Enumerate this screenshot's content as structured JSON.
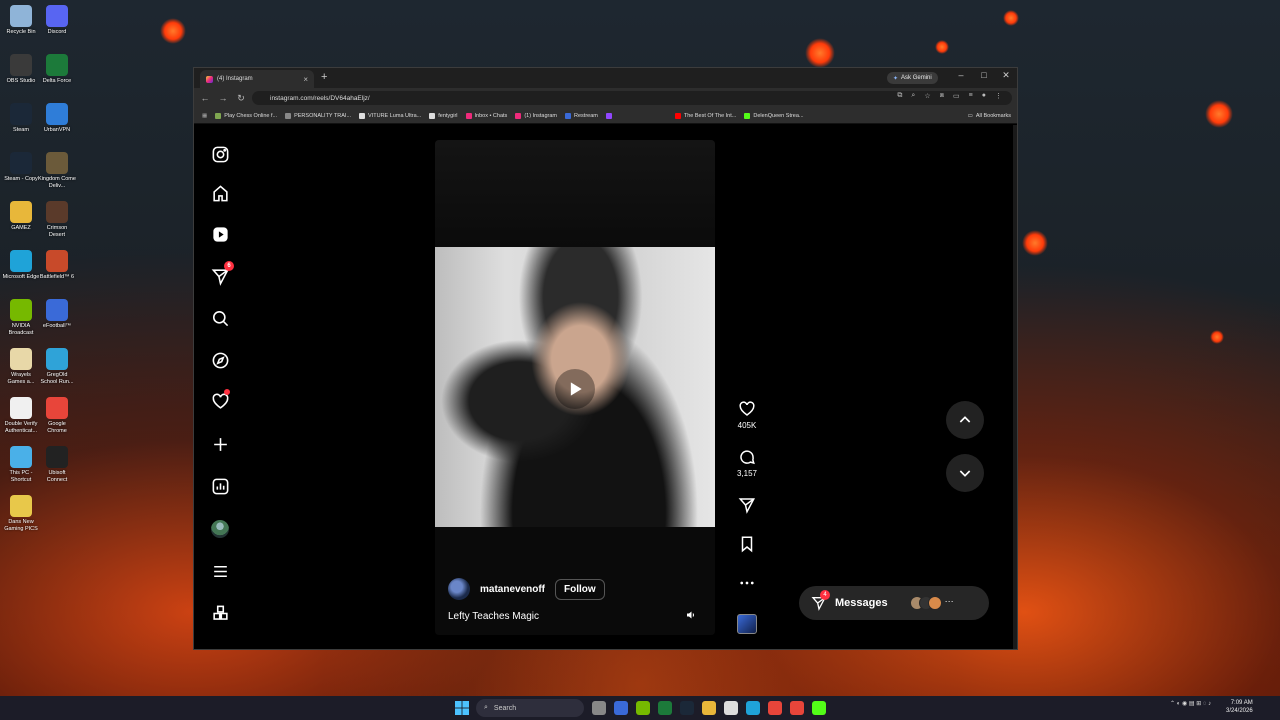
{
  "desktop": {
    "icons": [
      {
        "label": "Recycle Bin",
        "color": "#8fb4d8"
      },
      {
        "label": "Discord",
        "color": "#5865f2"
      },
      {
        "label": "OBS Studio",
        "color": "#3a3a3a"
      },
      {
        "label": "Delta Force",
        "color": "#1c7a3a"
      },
      {
        "label": "Steam",
        "color": "#1b2838"
      },
      {
        "label": "UrbanVPN",
        "color": "#2f7dd8"
      },
      {
        "label": "Steam - Copy",
        "color": "#1b2838"
      },
      {
        "label": "Kingdom Come Deliv...",
        "color": "#6b5a3a"
      },
      {
        "label": "GAMEZ",
        "color": "#e8b73a"
      },
      {
        "label": "Crimson Desert",
        "color": "#5a3a2a"
      },
      {
        "label": "Microsoft Edge",
        "color": "#1fa3d8"
      },
      {
        "label": "Battlefield™ 6",
        "color": "#c84a2a"
      },
      {
        "label": "NVIDIA Broadcast",
        "color": "#76b900"
      },
      {
        "label": "eFootball™",
        "color": "#3a6ad8"
      },
      {
        "label": "Wrayels Games a...",
        "color": "#e8d8a8"
      },
      {
        "label": "GregOld School Run...",
        "color": "#2fa3d8"
      },
      {
        "label": "Double Verify Authenticat...",
        "color": "#f0f0f0"
      },
      {
        "label": "Google Chrome",
        "color": "#e8453a"
      },
      {
        "label": "This PC - Shortcut",
        "color": "#4ab0e8"
      },
      {
        "label": "Ubisoft Connect",
        "color": "#222"
      },
      {
        "label": "Dans New Gaming PICS",
        "color": "#e8c84a"
      }
    ]
  },
  "browser": {
    "tab_title": "(4) Instagram",
    "new_tab": "+",
    "ask_gemini": "Ask Gemini",
    "url": "instagram.com/reels/DV64ahaEljz/",
    "bookmarks": [
      {
        "label": "Play Chess Online f...",
        "color": "#7fa650"
      },
      {
        "label": "PERSONALITY TRAI...",
        "color": "#888"
      },
      {
        "label": "VITURE Luma Ultra...",
        "color": "#ddd"
      },
      {
        "label": "fentygirl",
        "color": "#ddd"
      },
      {
        "label": "Inbox • Chats",
        "color": "#ee2a7b"
      },
      {
        "label": "(1) Instagram",
        "color": "#ee2a7b"
      },
      {
        "label": "Restream",
        "color": "#3a6ad8"
      },
      {
        "label": "",
        "color": "#9146ff"
      },
      {
        "label": "The Best Of The Int...",
        "color": "#ff0000"
      },
      {
        "label": "DelenQueen Strea...",
        "color": "#53fc18"
      }
    ],
    "all_bookmarks": "All Bookmarks"
  },
  "instagram": {
    "sidebar": {
      "messages_badge": "6"
    },
    "reel": {
      "author": "matanevenoff",
      "follow_label": "Follow",
      "caption": "Lefty Teaches Magic",
      "likes": "405K",
      "comments": "3,157"
    },
    "messages": {
      "label": "Messages",
      "badge": "4"
    }
  },
  "taskbar": {
    "search_placeholder": "Search",
    "time": "7:09 AM",
    "date": "3/24/2026"
  }
}
